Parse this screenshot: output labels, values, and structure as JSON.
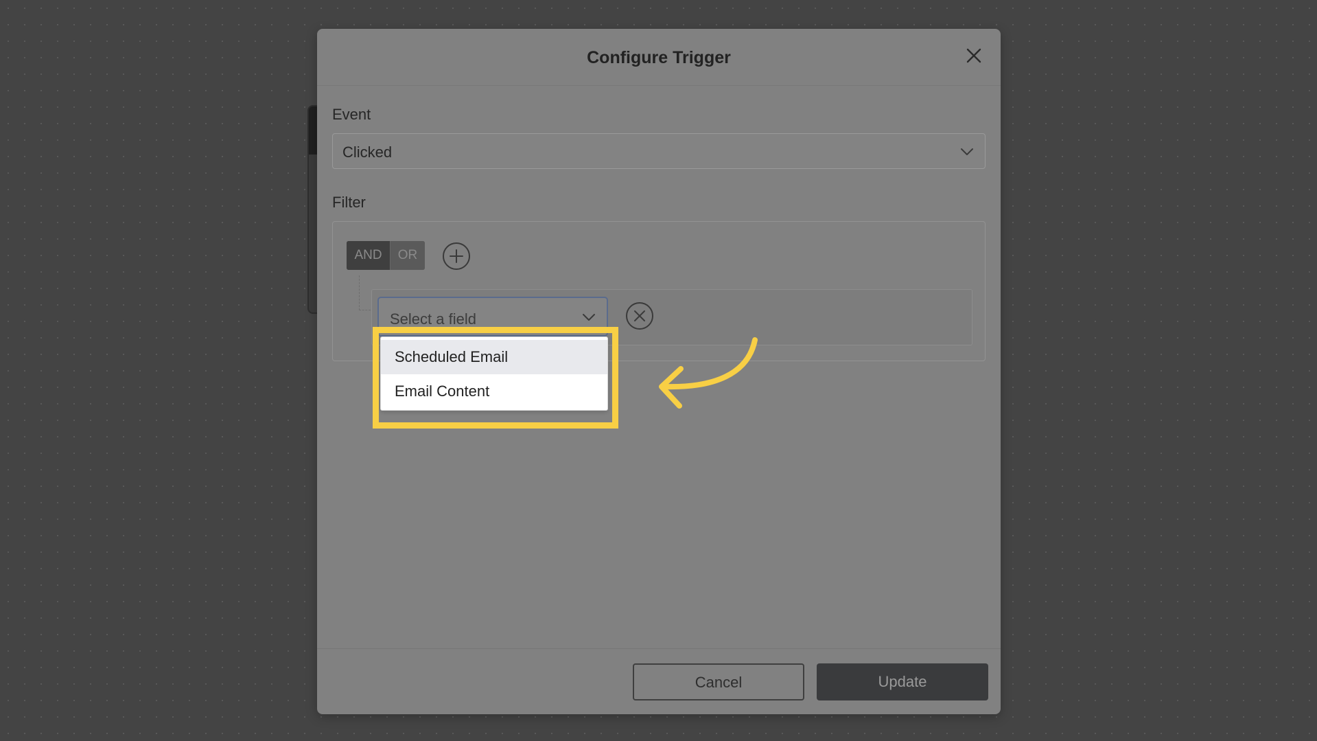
{
  "modal": {
    "title": "Configure Trigger",
    "close_icon": "close-icon"
  },
  "event": {
    "label": "Event",
    "value": "Clicked",
    "chevron_icon": "chevron-down-icon"
  },
  "filter": {
    "label": "Filter",
    "logic_toggle": {
      "and_label": "AND",
      "or_label": "OR",
      "selected": "AND"
    },
    "add_icon": "plus-circle-icon",
    "rule": {
      "field_placeholder": "Select a field",
      "remove_icon": "close-circle-icon"
    },
    "field_options": [
      {
        "label": "Scheduled Email",
        "highlighted": true
      },
      {
        "label": "Email Content",
        "highlighted": false
      }
    ]
  },
  "annotation": {
    "frame_color": "#f8cf45",
    "arrow_icon": "curved-arrow-icon"
  },
  "footer": {
    "cancel_label": "Cancel",
    "update_label": "Update"
  }
}
